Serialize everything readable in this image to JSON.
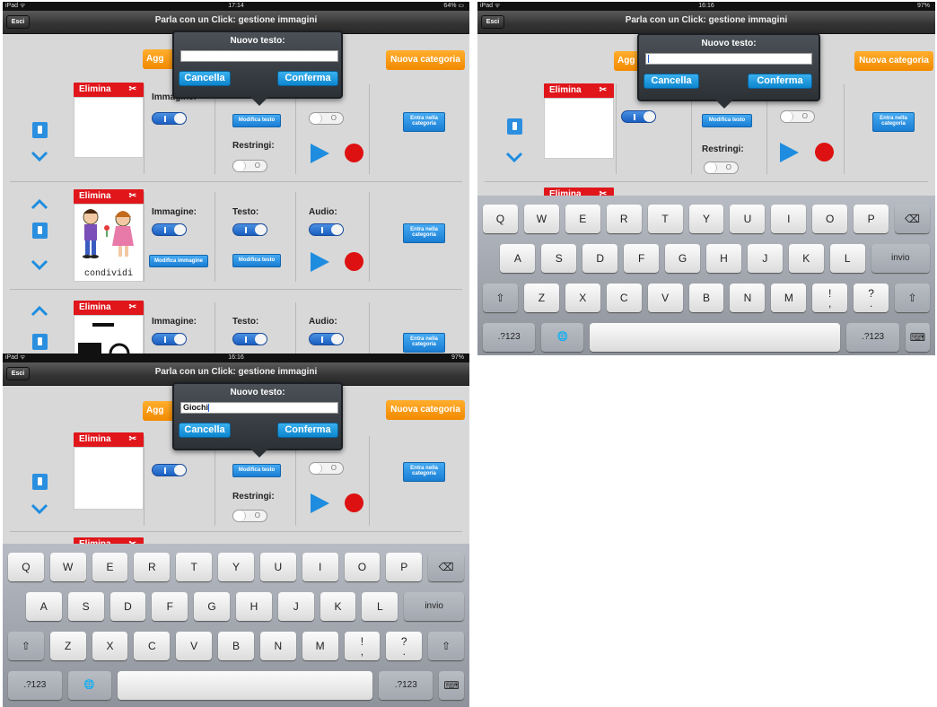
{
  "app": {
    "title": "Parla con un Click: gestione immagini",
    "esc_label": "Esci"
  },
  "status": {
    "device": "iPad ᯤ",
    "time_a": "17:14",
    "battery_a": "64% ▭",
    "time_b": "16:16",
    "battery_b": "97%",
    "time_c": "16:16",
    "battery_c": "97%"
  },
  "toolbar": {
    "add_label_partial": "Agg",
    "new_category": "Nuova categoria"
  },
  "dialog": {
    "title": "Nuovo testo:",
    "value_empty": "",
    "value_filled": "Giochi",
    "cancel": "Cancella",
    "confirm": "Conferma"
  },
  "row": {
    "delete": "Elimina",
    "delete_icon": "✂",
    "image": "Immagine:",
    "text": "Testo:",
    "audio": "Audio:",
    "restrict": "Restringi:",
    "edit_text": "Modifica testo",
    "edit_image": "Modifica immagine",
    "enter_category": "Entra nella categoria",
    "toggle_off_mark": "O",
    "caption_row2": "condividi"
  },
  "keyboard": {
    "row1": [
      "Q",
      "W",
      "E",
      "R",
      "T",
      "Y",
      "U",
      "I",
      "O",
      "P"
    ],
    "row2": [
      "A",
      "S",
      "D",
      "F",
      "G",
      "H",
      "J",
      "K",
      "L"
    ],
    "row3": [
      "Z",
      "X",
      "C",
      "V",
      "B",
      "N",
      "M"
    ],
    "return_key": "invio",
    "numbers_key": ".?123",
    "backspace_icon": "⌫",
    "shift_icon": "⇧",
    "globe_icon": "🌐",
    "hide_icon": "⌨",
    "excl": "!\n,",
    "quest": "?\n."
  }
}
